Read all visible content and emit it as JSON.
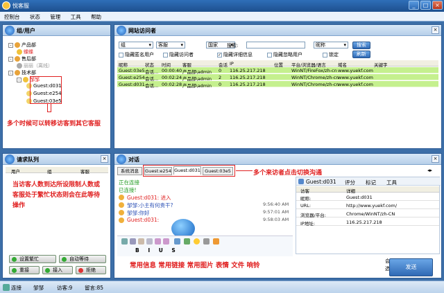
{
  "window": {
    "title": "悦客服",
    "min": "_",
    "max": "□",
    "close": "×"
  },
  "menu": [
    "控制台",
    "状态",
    "管理",
    "工具",
    "帮助"
  ],
  "groups_panel": {
    "title": "组/用户",
    "tree": [
      {
        "label": "产品部",
        "kind": "group",
        "indent": 0,
        "toggle": "-"
      },
      {
        "label": "蝶蝶",
        "kind": "agent",
        "indent": 1,
        "toggle": ""
      },
      {
        "label": "售后部",
        "kind": "group",
        "indent": 0,
        "toggle": "-"
      },
      {
        "label": "丽丽（离线）",
        "kind": "offline",
        "indent": 1,
        "toggle": ""
      },
      {
        "label": "技术部",
        "kind": "group",
        "indent": 0,
        "toggle": "-"
      },
      {
        "label": "邹邹",
        "kind": "agent",
        "indent": 1,
        "toggle": "-"
      },
      {
        "label": "Guest:d031",
        "kind": "guest",
        "indent": 2,
        "toggle": ""
      },
      {
        "label": "Guest:e254",
        "kind": "guest",
        "indent": 2,
        "toggle": ""
      },
      {
        "label": "Guest:03e5",
        "kind": "guest",
        "indent": 2,
        "toggle": ""
      }
    ],
    "note": "多个时候可以转移访客到其它客服"
  },
  "visitors_panel": {
    "title": "网站访问者",
    "filters": {
      "group": "组",
      "agent": "客服",
      "country": "国家",
      "search_label": "搜索:",
      "search_value": "",
      "category": "昵称",
      "search_btn": "搜索",
      "refresh_btn": "刷新"
    },
    "checks": [
      {
        "label": "隐藏匿名用户",
        "checked": false
      },
      {
        "label": "隐藏访问者",
        "checked": false
      },
      {
        "label": "隐藏详细信息",
        "checked": true
      },
      {
        "label": "隐藏忽略用户",
        "checked": false
      },
      {
        "label": "锁定",
        "checked": false
      }
    ],
    "columns": [
      "昵称",
      "状态",
      "时间",
      "客服",
      "会话",
      "IP",
      "位置",
      "平台/浏览器/语言",
      "域名",
      "关键字"
    ],
    "rows": [
      [
        "Guest:03e5",
        "会话...",
        "00:00:40",
        "产品部\\admin",
        "0",
        "116.25.217.218",
        "",
        "WinNT/FireFox/zh-cn",
        "www.yuekf.com",
        ""
      ],
      [
        "Guest:e254",
        "会话...",
        "00:02:24",
        "产品部\\admin",
        "2",
        "116.25.217.218",
        "",
        "WinNT/Chrome/zh-cn",
        "www.yuekf.com",
        ""
      ],
      [
        "Guest:d031",
        "会话...",
        "00:02:28",
        "产品部\\admin",
        "0",
        "116.25.217.218",
        "",
        "WinNT/Chrome/zh-cn",
        "www.yuekf.com",
        ""
      ]
    ]
  },
  "queue_panel": {
    "title": "请求队列",
    "columns": [
      "用户",
      "组",
      "客服"
    ],
    "note": "当访客人数到达所设限制人数或客服处于繁忙状态则会在此等待操作",
    "buttons": [
      "设置繁忙",
      "自动等待",
      "重接",
      "接入",
      "拒绝"
    ]
  },
  "dialog_panel": {
    "title": "对话",
    "tabs": [
      "系统消息",
      "Guest:e254",
      "Guest:d031",
      "Guest:03e5"
    ],
    "tabs_note": "多个来访者点击切换沟通",
    "messages": [
      {
        "text": "正在连接",
        "time": "",
        "color": "#1f9a1f",
        "icon": false
      },
      {
        "text": "已连接!",
        "time": "",
        "color": "#1f9a1f",
        "icon": false
      },
      {
        "text": "Guest:d031: 进入",
        "time": "",
        "color": "#e02020",
        "icon": true
      },
      {
        "text": "邹邹:小主有何贵干?",
        "time": "9:56:40 AM",
        "color": "#2a4fb5",
        "icon": true
      },
      {
        "text": "邹邹:你好",
        "time": "9:57:01 AM",
        "color": "#2a4fb5",
        "icon": true
      },
      {
        "text": "Guest:d031:",
        "time": "9:58:03 AM",
        "color": "#e02020",
        "icon": true
      }
    ],
    "toolbar_note": "常用信息 常用链接 常用图片 表情 文件 响铃",
    "info": {
      "header": "Guest:d031",
      "actions": [
        "评分",
        "标记",
        "工具"
      ],
      "columns": [
        "访客",
        "详细"
      ],
      "rows": [
        [
          "昵称:",
          "Guest:d031"
        ],
        [
          "URL:",
          "http://www.yuekf.com/"
        ],
        [
          "浏览器/平台:",
          "Chrome/WinNT/zh-CN"
        ],
        [
          "IP地址:",
          "116.25.217.218"
        ]
      ]
    },
    "session_list": "会话列表",
    "options": "选项",
    "send": "发送"
  },
  "status": {
    "connect": "连接",
    "agent": "邹邹",
    "visitors": "访客:9",
    "messages": "留言:85"
  }
}
